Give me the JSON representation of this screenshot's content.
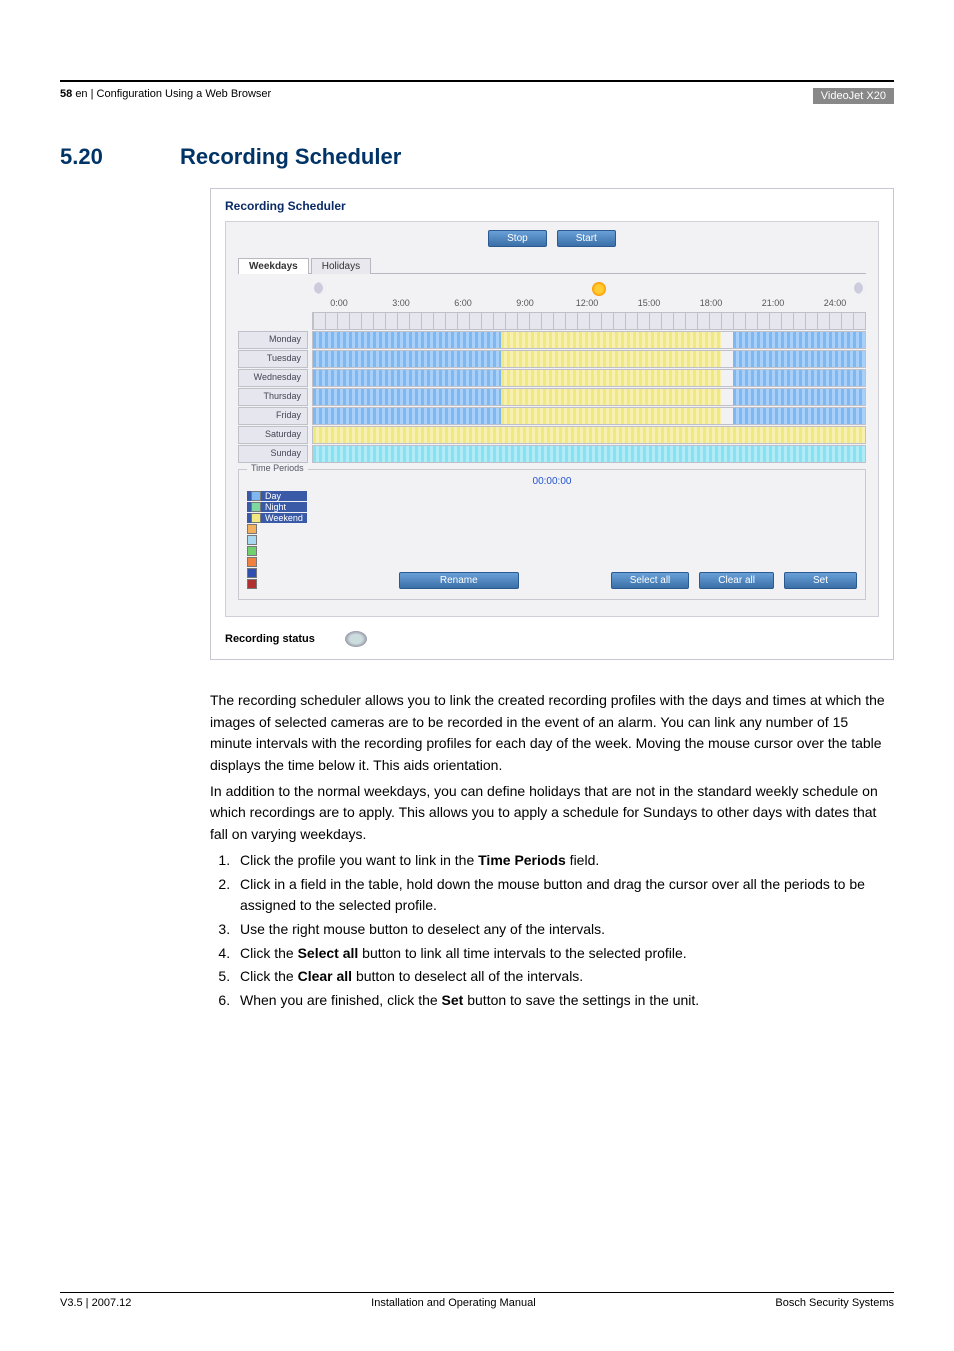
{
  "header": {
    "page_num": "58",
    "breadcrumb": "en | Configuration Using a Web Browser",
    "product": "VideoJet X20"
  },
  "section": {
    "num": "5.20",
    "title": "Recording Scheduler"
  },
  "shot": {
    "title": "Recording Scheduler",
    "stop": "Stop",
    "start": "Start",
    "tabs": {
      "weekdays": "Weekdays",
      "holidays": "Holidays"
    },
    "hours": [
      "0:00",
      "3:00",
      "6:00",
      "9:00",
      "12:00",
      "15:00",
      "18:00",
      "21:00",
      "24:00"
    ],
    "days": [
      "Monday",
      "Tuesday",
      "Wednesday",
      "Thursday",
      "Friday",
      "Saturday",
      "Sunday"
    ],
    "tp_legend": "Time Periods",
    "tp_clock": "00:00:00",
    "tp_items": [
      "Day",
      "Night",
      "Weekend"
    ],
    "tp_colors": [
      "#7fb8f0",
      "#7fd8a0",
      "#f0e880",
      "#f0b060",
      "#a8d8f0",
      "#f08080",
      "#5060c0",
      "#b04040"
    ],
    "btn_rename": "Rename",
    "btn_selectall": "Select all",
    "btn_clearall": "Clear all",
    "btn_set": "Set",
    "status_label": "Recording status"
  },
  "text": {
    "p1": "The recording scheduler allows you to link the created recording profiles with the days and times at which the images of selected cameras are to be recorded in the event of an alarm. You can link any number of 15 minute intervals with the recording profiles for each day of the week. Moving the mouse cursor over the table displays the time below it. This aids orientation.",
    "p2": "In addition to the normal weekdays, you can define holidays that are not in the standard weekly schedule on which recordings are to apply. This allows you to apply a schedule for Sundays to other days with dates that fall on varying weekdays.",
    "s1a": "Click the profile you want to link in the ",
    "s1b": "Time Periods",
    "s1c": " field.",
    "s2": "Click in a field in the table, hold down the mouse button and drag the cursor over all the periods to be assigned to the selected profile.",
    "s3": "Use the right mouse button to deselect any of the intervals.",
    "s4a": "Click the ",
    "s4b": "Select all",
    "s4c": " button to link all time intervals to the selected profile.",
    "s5a": "Click the ",
    "s5b": "Clear all",
    "s5c": " button to deselect all of the intervals.",
    "s6a": "When you are finished, click the ",
    "s6b": "Set",
    "s6c": " button to save the settings in the unit."
  },
  "footer": {
    "left": "V3.5 | 2007.12",
    "center": "Installation and Operating Manual",
    "right": "Bosch Security Systems"
  }
}
